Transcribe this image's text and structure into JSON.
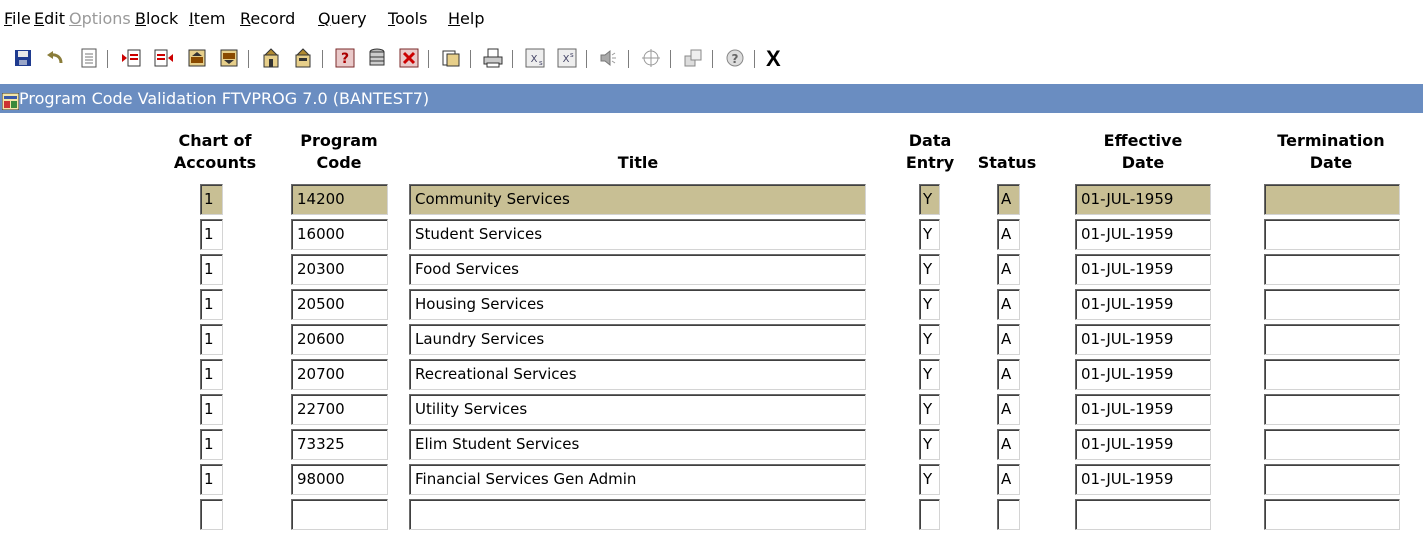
{
  "menu": [
    {
      "pre": "",
      "mn": "F",
      "post": "ile",
      "disabled": false
    },
    {
      "pre": "",
      "mn": "E",
      "post": "dit",
      "disabled": false
    },
    {
      "pre": "",
      "mn": "O",
      "post": "ptions",
      "disabled": true
    },
    {
      "pre": "",
      "mn": "B",
      "post": "lock",
      "disabled": false
    },
    {
      "pre": "",
      "mn": "I",
      "post": "tem",
      "disabled": false
    },
    {
      "pre": "",
      "mn": "R",
      "post": "ecord",
      "disabled": false
    },
    {
      "pre": "",
      "mn": "Q",
      "post": "uery",
      "disabled": false
    },
    {
      "pre": "",
      "mn": "T",
      "post": "ools",
      "disabled": false
    },
    {
      "pre": "",
      "mn": "H",
      "post": "elp",
      "disabled": false
    }
  ],
  "toolbar": {
    "exit_label": "X",
    "buttons": [
      "save-icon",
      "rollback-icon",
      "print-doc-icon",
      "insert-record-icon",
      "remove-record-icon",
      "previous-block-icon",
      "next-block-icon",
      "enter-query-icon",
      "execute-query-icon",
      "help-question-icon",
      "database-icon",
      "cancel-query-icon",
      "duplicate-icon",
      "printer-icon",
      "extract-data-icon",
      "extract-all-icon",
      "audio-icon",
      "navigate-icon",
      "options-icon",
      "help-circle-icon"
    ]
  },
  "window": {
    "title": "Program Code Validation  FTVPROG  7.0  (BANTEST7)"
  },
  "columns": {
    "chart": [
      "Chart of",
      "Accounts"
    ],
    "program": [
      "Program",
      "Code"
    ],
    "title": [
      "",
      "Title"
    ],
    "data_entry": [
      "Data",
      "Entry"
    ],
    "status": [
      "",
      "Status"
    ],
    "effective": [
      "Effective",
      "Date"
    ],
    "termination": [
      "Termination",
      "Date"
    ]
  },
  "rows": [
    {
      "chart": "1",
      "program": "14200",
      "title": "Community Services",
      "data_entry": "Y",
      "status": "A",
      "effective": "01-JUL-1959",
      "termination": ""
    },
    {
      "chart": "1",
      "program": "16000",
      "title": "Student Services",
      "data_entry": "Y",
      "status": "A",
      "effective": "01-JUL-1959",
      "termination": ""
    },
    {
      "chart": "1",
      "program": "20300",
      "title": "Food Services",
      "data_entry": "Y",
      "status": "A",
      "effective": "01-JUL-1959",
      "termination": ""
    },
    {
      "chart": "1",
      "program": "20500",
      "title": "Housing Services",
      "data_entry": "Y",
      "status": "A",
      "effective": "01-JUL-1959",
      "termination": ""
    },
    {
      "chart": "1",
      "program": "20600",
      "title": "Laundry Services",
      "data_entry": "Y",
      "status": "A",
      "effective": "01-JUL-1959",
      "termination": ""
    },
    {
      "chart": "1",
      "program": "20700",
      "title": "Recreational Services",
      "data_entry": "Y",
      "status": "A",
      "effective": "01-JUL-1959",
      "termination": ""
    },
    {
      "chart": "1",
      "program": "22700",
      "title": "Utility Services",
      "data_entry": "Y",
      "status": "A",
      "effective": "01-JUL-1959",
      "termination": ""
    },
    {
      "chart": "1",
      "program": "73325",
      "title": "Elim Student Services",
      "data_entry": "Y",
      "status": "A",
      "effective": "01-JUL-1959",
      "termination": ""
    },
    {
      "chart": "1",
      "program": "98000",
      "title": "Financial Services Gen Admin",
      "data_entry": "Y",
      "status": "A",
      "effective": "01-JUL-1959",
      "termination": ""
    },
    {
      "chart": "",
      "program": "",
      "title": "",
      "data_entry": "",
      "status": "",
      "effective": "",
      "termination": ""
    }
  ],
  "colors": {
    "titlebar": "#6a8dc1",
    "selected_row": "#c8bf94",
    "disabled_menu": "#9a9a9a"
  }
}
